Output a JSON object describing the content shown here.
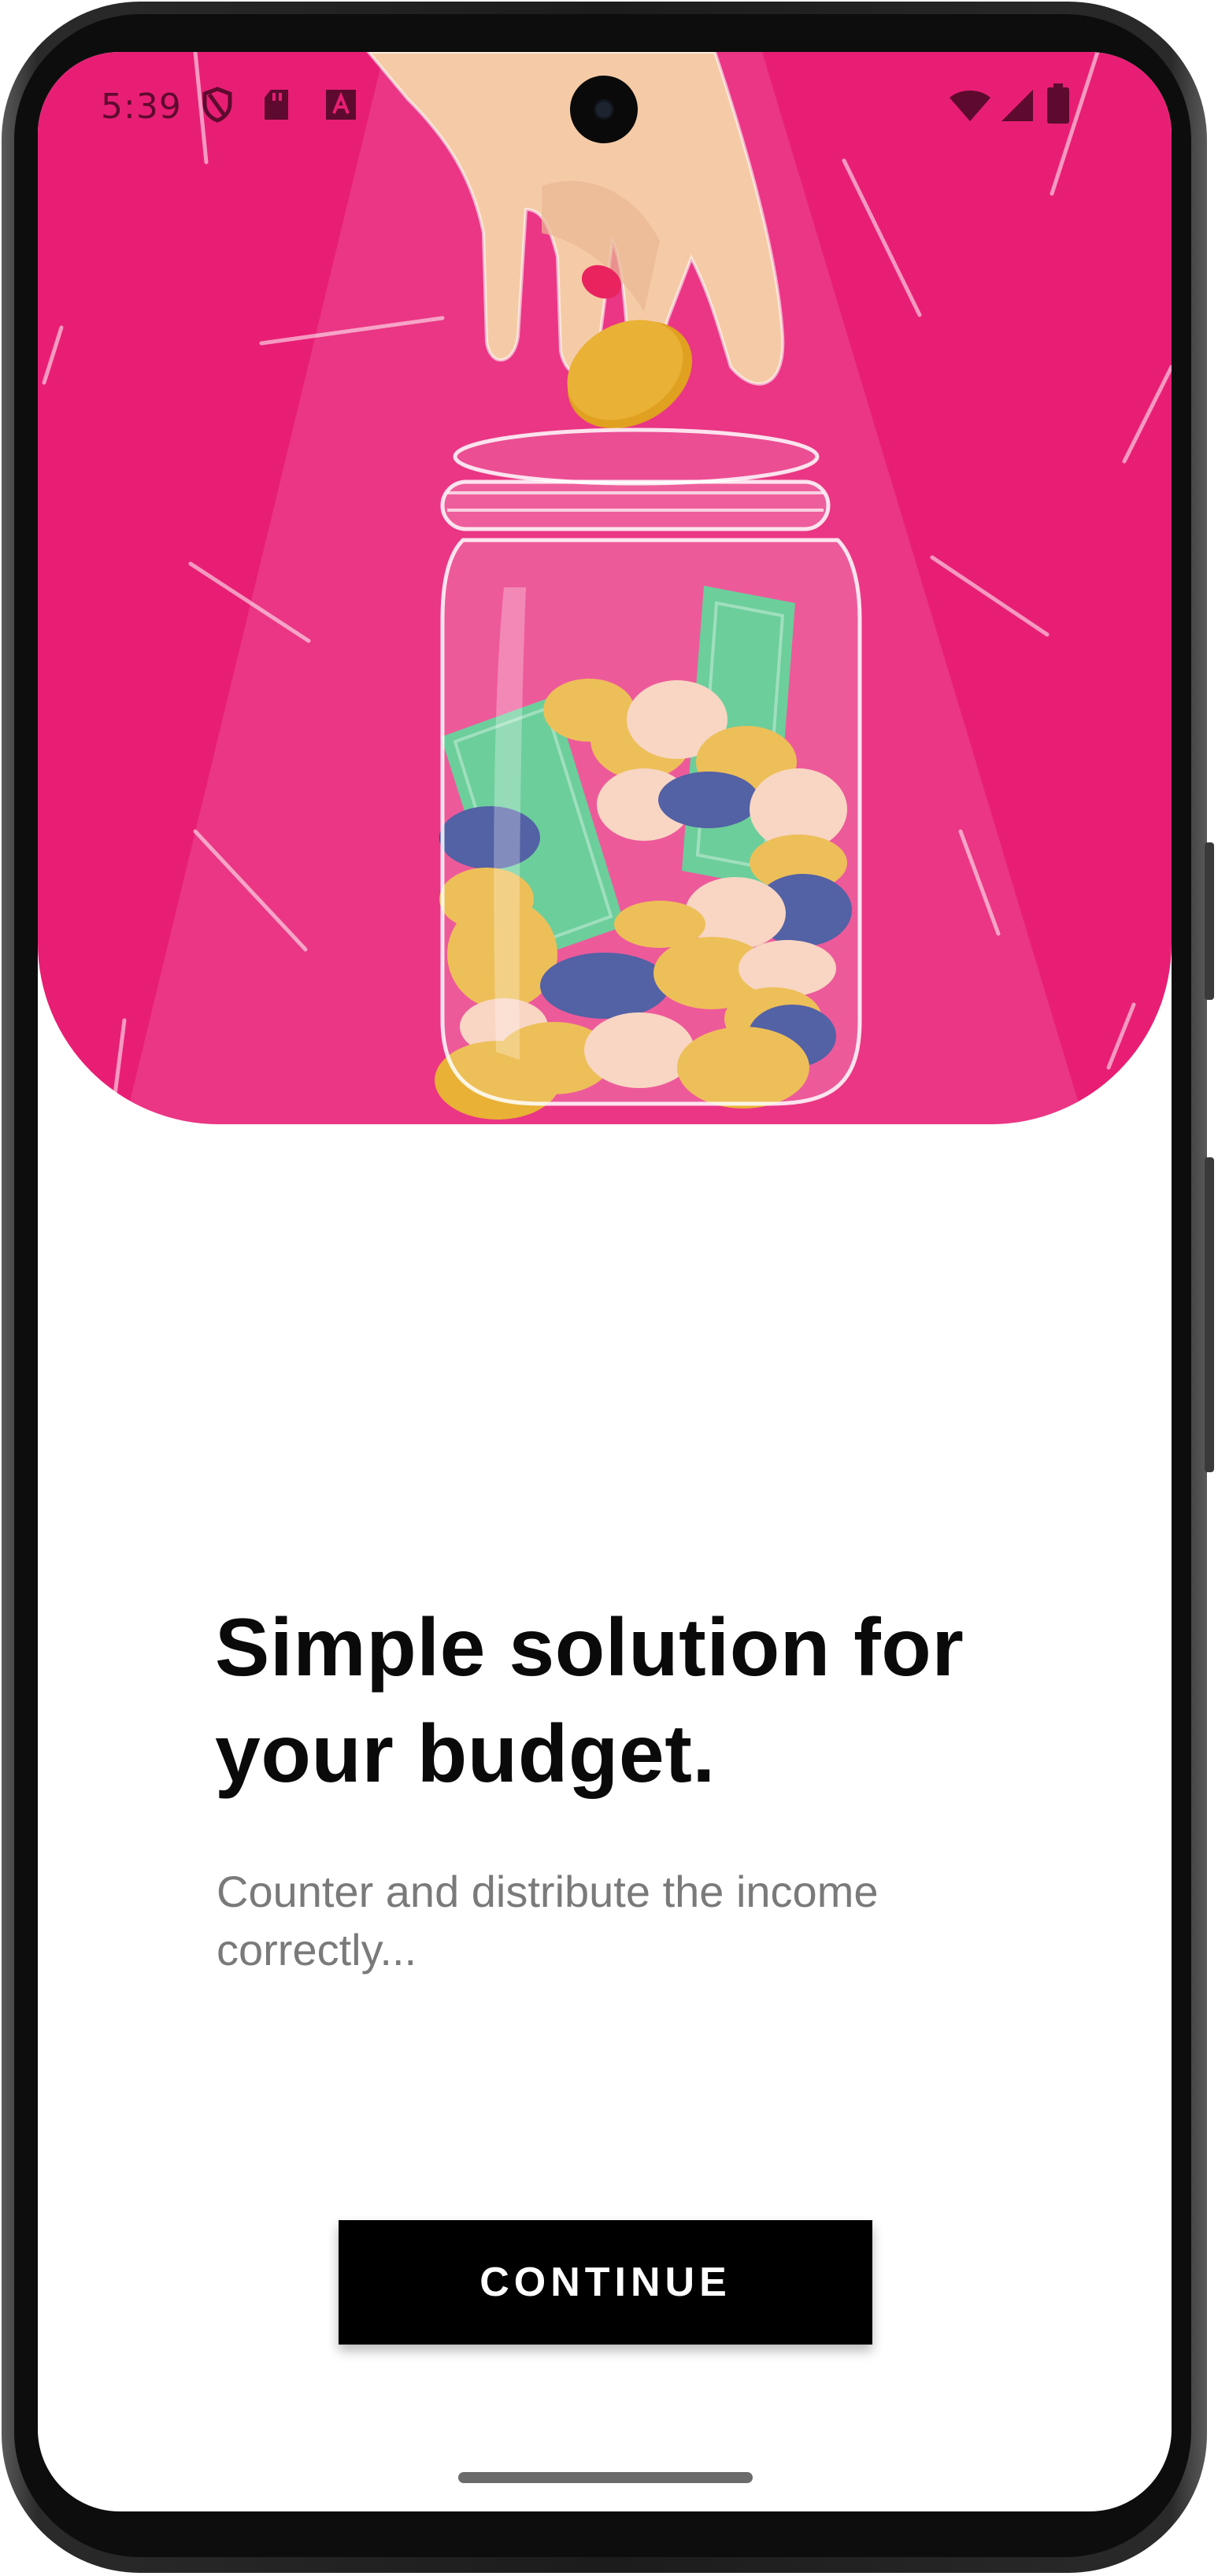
{
  "status_bar": {
    "time": "5:39",
    "left_icons": [
      "shield-icon",
      "sd-card-icon",
      "font-a-icon"
    ],
    "right_icons": [
      "wifi-icon",
      "cellular-signal-icon",
      "battery-icon"
    ]
  },
  "hero": {
    "illustration": "hand-dropping-coin-into-money-jar",
    "background_color": "#E81E75"
  },
  "content": {
    "headline": "Simple solution for your budget.",
    "subtext": "Counter and distribute the income correctly..."
  },
  "actions": {
    "continue_label": "CONTINUE"
  },
  "colors": {
    "accent": "#E81E75",
    "button_background": "#000000",
    "button_text": "#FFFFFF",
    "coin_gold": "#E9B135",
    "coin_peach": "#F7CDB6",
    "coin_navy": "#2E3F92",
    "banknote_green": "#4CC486"
  }
}
